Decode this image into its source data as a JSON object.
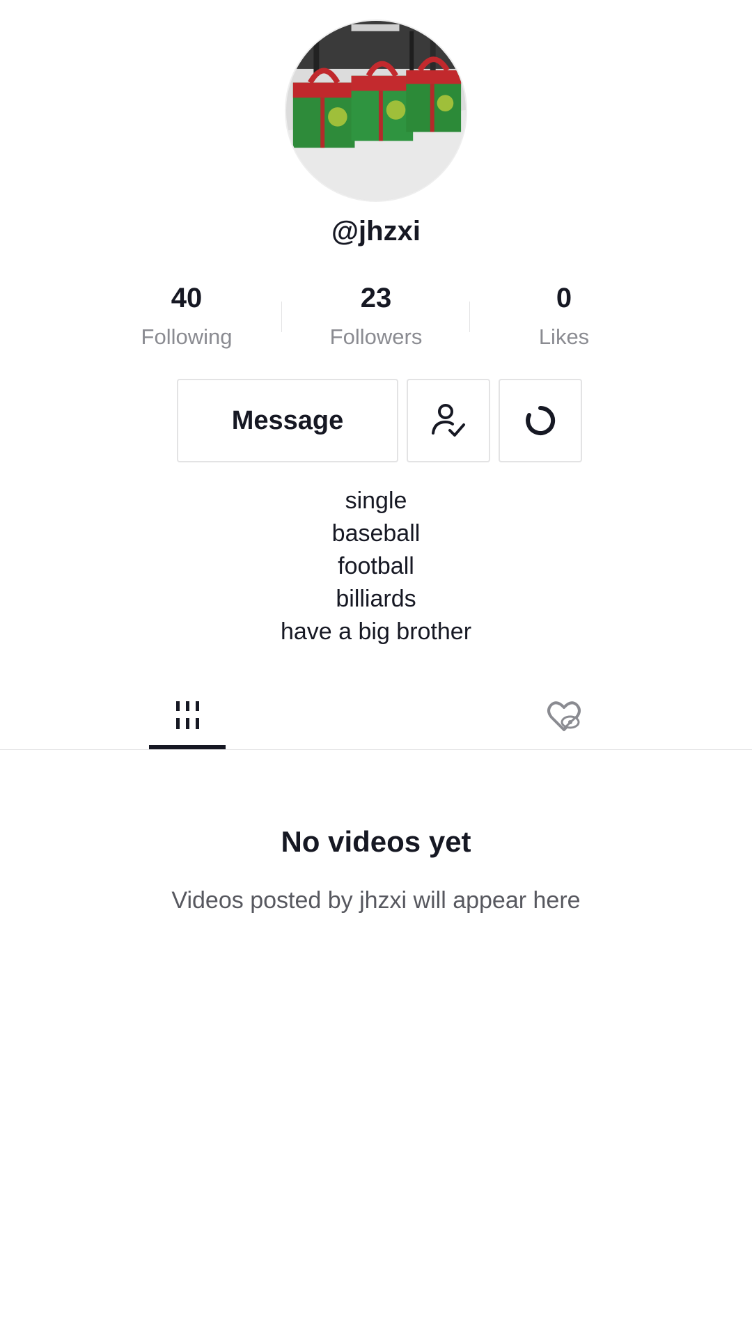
{
  "profile": {
    "username": "@jhzxi",
    "avatar_icon": "gift-boxes-photo"
  },
  "stats": {
    "following": {
      "value": "40",
      "label": "Following"
    },
    "followers": {
      "value": "23",
      "label": "Followers"
    },
    "likes": {
      "value": "0",
      "label": "Likes"
    }
  },
  "actions": {
    "message_label": "Message",
    "followed_icon": "user-check-icon",
    "more_icon": "refresh-icon"
  },
  "bio": [
    "single",
    "baseball",
    "football",
    "billiards",
    "have a big brother"
  ],
  "tabs": {
    "videos_icon": "grid-icon",
    "liked_icon": "hidden-heart-icon",
    "active": "videos"
  },
  "empty_state": {
    "title": "No videos yet",
    "subtitle": "Videos posted by jhzxi will appear here"
  },
  "colors": {
    "text_primary": "#161823",
    "text_secondary": "#8a8b91",
    "border": "#e3e3e4"
  }
}
